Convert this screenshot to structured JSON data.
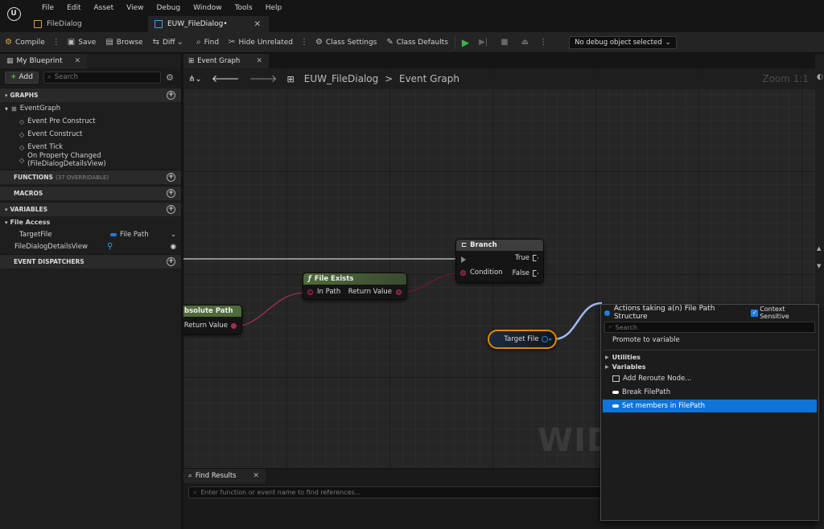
{
  "menu": [
    "File",
    "Edit",
    "Asset",
    "View",
    "Debug",
    "Window",
    "Tools",
    "Help"
  ],
  "doc_tabs": [
    {
      "label": "FileDialog"
    },
    {
      "label": "EUW_FileDialog•"
    }
  ],
  "toolbar": {
    "compile": "Compile",
    "save": "Save",
    "browse": "Browse",
    "diff": "Diff",
    "find": "Find",
    "hide_unrelated": "Hide Unrelated",
    "class_settings": "Class Settings",
    "class_defaults": "Class Defaults",
    "debug_select": "No debug object selected"
  },
  "my_blueprint": {
    "tab_label": "My Blueprint",
    "add_label": "Add",
    "search_placeholder": "Search",
    "graphs_header": "GRAPHS",
    "event_graph": "EventGraph",
    "events": [
      "Event Pre Construct",
      "Event Construct",
      "Event Tick",
      "On Property Changed (FileDialogDetailsView)"
    ],
    "functions_header": "FUNCTIONS",
    "functions_sub": "(37 OVERRIDABLE)",
    "macros_header": "MACROS",
    "variables_header": "VARIABLES",
    "var_category": "File Access",
    "variables": [
      {
        "name": "TargetFile",
        "type": "File Path"
      },
      {
        "name": "FileDialogDetailsView",
        "type": ""
      }
    ],
    "dispatchers_header": "EVENT DISPATCHERS"
  },
  "graph": {
    "tab_label": "Event Graph",
    "breadcrumb_bp": "EUW_FileDialog",
    "breadcrumb_sep": ">",
    "breadcrumb_graph": "Event Graph",
    "zoom": "Zoom 1:1",
    "watermark": "WIDG",
    "nodes": {
      "branch": {
        "title": "Branch",
        "true_pin": "True",
        "false_pin": "False",
        "condition_pin": "Condition"
      },
      "file_exists": {
        "title": "File Exists",
        "in_pin": "In Path",
        "out_pin": "Return Value"
      },
      "abs_path": {
        "title": "bsolute Path",
        "out_pin": "Return Value"
      },
      "target_file": {
        "title": "Target File"
      }
    }
  },
  "find_results": {
    "tab_label": "Find Results",
    "placeholder": "Enter function or event name to find references..."
  },
  "action_menu": {
    "title": "Actions taking a(n) File Path Structure",
    "context_label": "Context Sensitive",
    "search_placeholder": "Search",
    "promote": "Promote to variable",
    "categories": [
      "Utilities",
      "Variables"
    ],
    "items": [
      {
        "label": "Add Reroute Node..."
      },
      {
        "label": "Break FilePath"
      },
      {
        "label": "Set members in FilePath"
      }
    ]
  },
  "colors": {
    "accent_blue": "#0e74d8",
    "play_green": "#3cb44b",
    "branch_header": "#3d3d3d",
    "file_exists_header": "#4f6b3a",
    "target_outline": "#e08a00"
  }
}
